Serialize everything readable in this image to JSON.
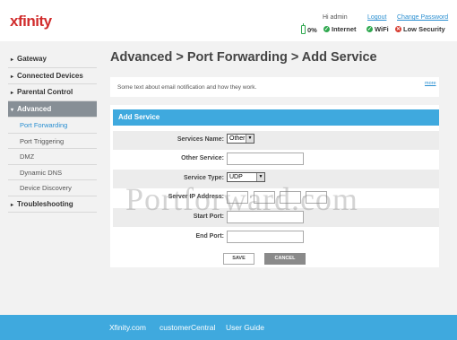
{
  "header": {
    "logo": "xfinity",
    "greeting": "Hi admin",
    "logout_label": "Logout",
    "change_password_label": "Change Password",
    "status": {
      "battery": "0%",
      "internet": "Internet",
      "wifi": "WiFi",
      "security": "Low Security"
    }
  },
  "sidebar": {
    "items": [
      {
        "label": "Gateway"
      },
      {
        "label": "Connected Devices"
      },
      {
        "label": "Parental Control"
      },
      {
        "label": "Advanced"
      },
      {
        "label": "Troubleshooting"
      }
    ],
    "sub_items": [
      {
        "label": "Port Forwarding"
      },
      {
        "label": "Port Triggering"
      },
      {
        "label": "DMZ"
      },
      {
        "label": "Dynamic DNS"
      },
      {
        "label": "Device Discovery"
      }
    ]
  },
  "main": {
    "title": "Advanced > Port Forwarding > Add Service",
    "info_text": "Some text about email notification and how they work.",
    "more_label": "more",
    "form": {
      "header": "Add Service",
      "services_name_label": "Services Name:",
      "services_name_value": "Other",
      "other_service_label": "Other Service:",
      "service_type_label": "Service Type:",
      "service_type_value": "UDP",
      "server_ip_label": "Server IP Address:",
      "start_port_label": "Start Port:",
      "end_port_label": "End Port:",
      "save_label": "SAVE",
      "cancel_label": "CANCEL"
    }
  },
  "watermark": "Portforward.com",
  "footer": {
    "links": [
      "Xfinity.com",
      "customerCentral",
      "User Guide"
    ]
  },
  "colors": {
    "accent": "#3fa9de",
    "brand_red": "#d12c2c",
    "status_green": "#2fa84f",
    "status_red": "#d63b2f"
  }
}
